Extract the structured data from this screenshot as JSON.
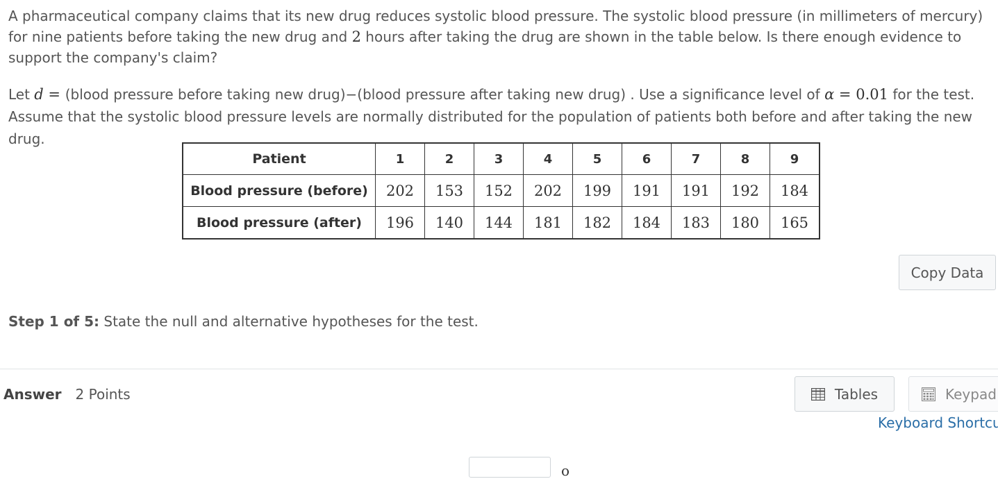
{
  "problem": {
    "para1_a": "A pharmaceutical company claims that its new drug reduces systolic blood pressure. The systolic blood pressure (in millimeters of mercury) for nine patients before taking the new drug and ",
    "para1_hours": "2",
    "para1_b": " hours after taking the drug are shown in the table below. Is there enough evidence to support the company's claim?",
    "para2_let": "Let ",
    "para2_var": "d",
    "para2_eq": " = ",
    "para2_def": " (blood pressure before taking new drug)−(blood pressure after taking new drug) . Use a significance level of ",
    "para2_alpha": "α",
    "para2_alpha_eq": " = ",
    "para2_alpha_val": "0.01",
    "para2_tail": " for the test.",
    "para3": "Assume that the systolic blood pressure levels are normally distributed for the population of patients both before and after taking the new drug."
  },
  "table": {
    "header_label": "Patient",
    "patients": [
      "1",
      "2",
      "3",
      "4",
      "5",
      "6",
      "7",
      "8",
      "9"
    ],
    "rows": [
      {
        "label": "Blood pressure (before)",
        "values": [
          "202",
          "153",
          "152",
          "202",
          "199",
          "191",
          "191",
          "192",
          "184"
        ]
      },
      {
        "label": "Blood pressure (after)",
        "values": [
          "196",
          "140",
          "144",
          "181",
          "182",
          "184",
          "183",
          "180",
          "165"
        ]
      }
    ]
  },
  "copy_button": "Copy Data",
  "step": {
    "label": "Step 1 of 5:",
    "text": " State the null and alternative hypotheses for the test."
  },
  "answer": {
    "label": "Answer",
    "points": "2 Points"
  },
  "tools": {
    "tables_label": "Tables",
    "keypad_label": "Keypad",
    "keyboard_link": "Keyboard Shortcu"
  },
  "icons": {
    "tables": "table-grid-icon",
    "keypad": "calculator-keypad-icon"
  },
  "partial_mark": "o"
}
